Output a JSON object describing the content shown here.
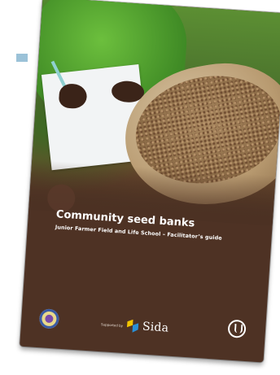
{
  "cover": {
    "title": "Community seed banks",
    "subtitle": "Junior Farmer Field and Life School – Facilitator’s guide",
    "supported_by_label": "Supported by",
    "sponsor_name": "Sida",
    "logos": [
      "institution-emblem-icon",
      "sida-logo-icon",
      "fao-logo-icon"
    ],
    "colors": {
      "cover_brown": "#4e3224",
      "accent_blue_tab": "#9bc2d8",
      "sida_yellow": "#f2c400",
      "sida_blue": "#2a8fd6"
    }
  }
}
